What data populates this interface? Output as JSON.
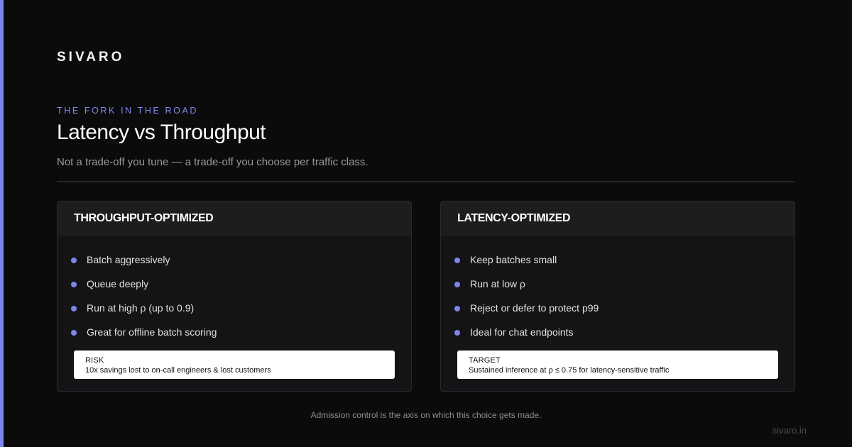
{
  "brand": "SIVARO",
  "eyebrow": "THE FORK IN THE ROAD",
  "title": "Latency vs Throughput",
  "subtitle": "Not a trade-off you tune — a trade-off you choose per traffic class.",
  "colors": {
    "accent": "#7b86f0",
    "background": "#0b0b0c",
    "card": "#141416",
    "card_header": "#1d1d20"
  },
  "cards": [
    {
      "heading": "THROUGHPUT-OPTIMIZED",
      "items": [
        "Batch aggressively",
        "Queue deeply",
        "Run at high ρ (up to 0.9)",
        "Great for offline batch scoring"
      ],
      "note": {
        "label": "RISK",
        "text": "10x savings lost to on-call engineers & lost customers"
      }
    },
    {
      "heading": "LATENCY-OPTIMIZED",
      "items": [
        "Keep batches small",
        "Run at low ρ",
        "Reject or defer to protect p99",
        "Ideal for chat endpoints"
      ],
      "note": {
        "label": "TARGET",
        "text": "Sustained inference at ρ ≤ 0.75 for latency-sensitive traffic"
      }
    }
  ],
  "footnote": "Admission control is the axis on which this choice gets made.",
  "site": "sivaro.in"
}
